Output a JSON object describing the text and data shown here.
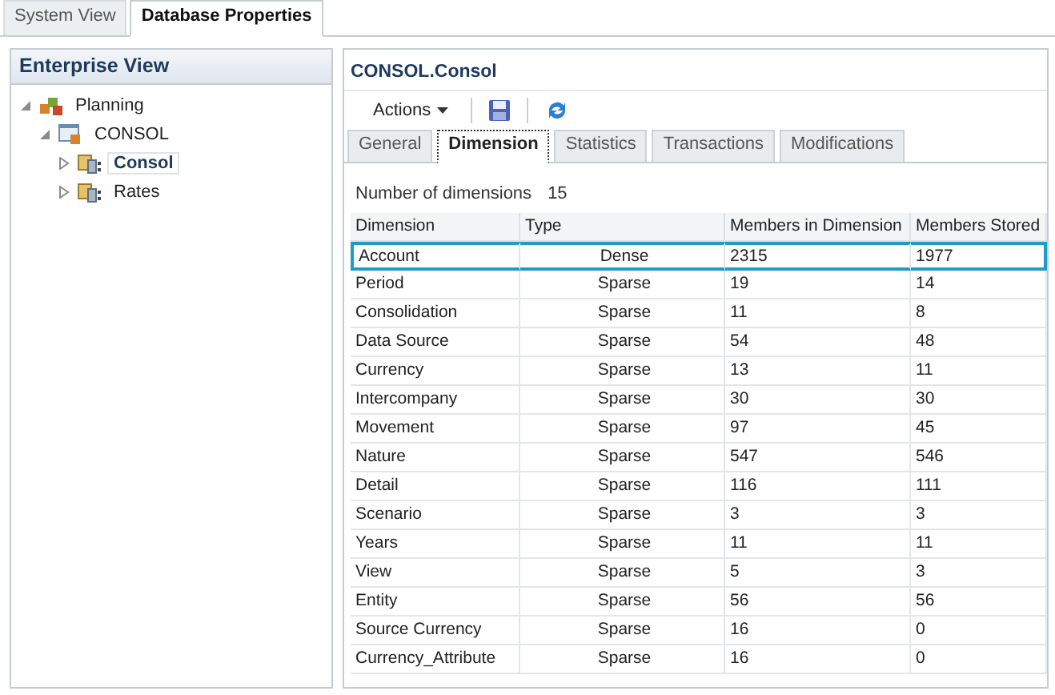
{
  "top_tabs": [
    {
      "label": "System View",
      "selected": false
    },
    {
      "label": "Database Properties",
      "selected": true
    }
  ],
  "sidebar": {
    "title": "Enterprise View",
    "tree": [
      {
        "label": "Planning",
        "kind": "application",
        "expanded": true,
        "selected": false,
        "children": [
          {
            "label": "CONSOL",
            "kind": "database",
            "expanded": true,
            "selected": false,
            "children": [
              {
                "label": "Consol",
                "kind": "cube",
                "expanded": false,
                "selected": true
              },
              {
                "label": "Rates",
                "kind": "cube",
                "expanded": false,
                "selected": false
              }
            ]
          }
        ]
      }
    ]
  },
  "panel": {
    "title": "CONSOL.Consol",
    "toolbar": {
      "actions_label": "Actions"
    },
    "tabs": [
      {
        "label": "General",
        "selected": false
      },
      {
        "label": "Dimension",
        "selected": true
      },
      {
        "label": "Statistics",
        "selected": false
      },
      {
        "label": "Transactions",
        "selected": false
      },
      {
        "label": "Modifications",
        "selected": false
      }
    ],
    "count_label": "Number of dimensions",
    "count_value": "15",
    "table": {
      "columns": [
        "Dimension",
        "Type",
        "Members in Dimension",
        "Members Stored"
      ],
      "rows": [
        {
          "cells": [
            "Account",
            "Dense",
            "2315",
            "1977"
          ],
          "selected": true
        },
        {
          "cells": [
            "Period",
            "Sparse",
            "19",
            "14"
          ],
          "selected": false
        },
        {
          "cells": [
            "Consolidation",
            "Sparse",
            "11",
            "8"
          ],
          "selected": false
        },
        {
          "cells": [
            "Data Source",
            "Sparse",
            "54",
            "48"
          ],
          "selected": false
        },
        {
          "cells": [
            "Currency",
            "Sparse",
            "13",
            "11"
          ],
          "selected": false
        },
        {
          "cells": [
            "Intercompany",
            "Sparse",
            "30",
            "30"
          ],
          "selected": false
        },
        {
          "cells": [
            "Movement",
            "Sparse",
            "97",
            "45"
          ],
          "selected": false
        },
        {
          "cells": [
            "Nature",
            "Sparse",
            "547",
            "546"
          ],
          "selected": false
        },
        {
          "cells": [
            "Detail",
            "Sparse",
            "116",
            "111"
          ],
          "selected": false
        },
        {
          "cells": [
            "Scenario",
            "Sparse",
            "3",
            "3"
          ],
          "selected": false
        },
        {
          "cells": [
            "Years",
            "Sparse",
            "11",
            "11"
          ],
          "selected": false
        },
        {
          "cells": [
            "View",
            "Sparse",
            "5",
            "3"
          ],
          "selected": false
        },
        {
          "cells": [
            "Entity",
            "Sparse",
            "56",
            "56"
          ],
          "selected": false
        },
        {
          "cells": [
            "Source Currency",
            "Sparse",
            "16",
            "0"
          ],
          "selected": false
        },
        {
          "cells": [
            "Currency_Attribute",
            "Sparse",
            "16",
            "0"
          ],
          "selected": false
        }
      ]
    }
  }
}
